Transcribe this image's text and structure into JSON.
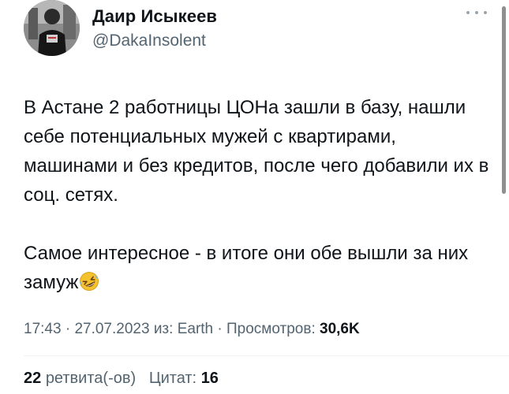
{
  "author": {
    "display_name": "Даир Исыкеев",
    "handle": "@DakaInsolent",
    "avatar_icon": "user-photo-avatar"
  },
  "tweet": {
    "paragraph_1": "В Астане 2 работницы ЦОНа зашли в базу, нашли себе потенциальных мужей с квартирами, машинами и без кредитов, после чего добавили их в соц. сетях.",
    "paragraph_2": "Самое интересное - в итоге они обе вышли за них замуж",
    "emoji_icon": "rolling-on-floor-laughing-emoji"
  },
  "meta": {
    "time": "17:43",
    "separator": "·",
    "date": "27.07.2023",
    "source_prefix": "из:",
    "source": "Earth",
    "views_label": "Просмотров:",
    "views_value": "30,6K"
  },
  "stats": {
    "retweets_count": "22",
    "retweets_label": "ретвита(-ов)",
    "quotes_label": "Цитат:",
    "quotes_count": "16"
  },
  "colors": {
    "primary_text": "#0f1419",
    "secondary_text": "#536471",
    "divider": "#eff3f4"
  }
}
